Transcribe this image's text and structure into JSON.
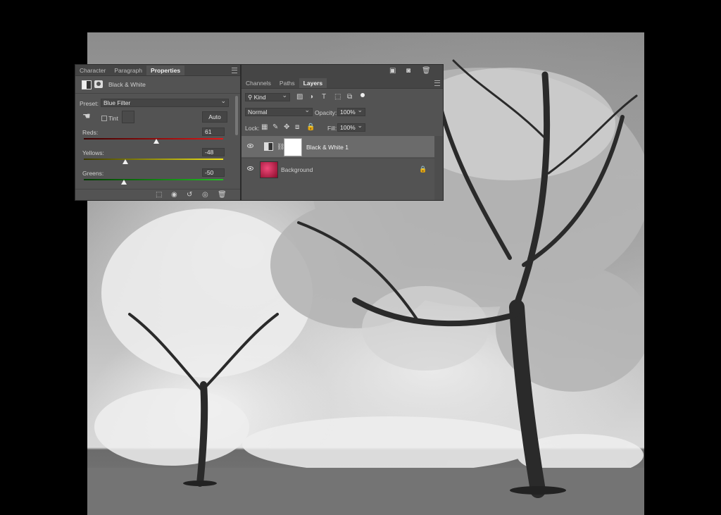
{
  "properties_panel": {
    "tabs": [
      "Character",
      "Paragraph",
      "Properties"
    ],
    "active_tab": "Properties",
    "adjustment_name": "Black & White",
    "preset_label": "Preset:",
    "preset_value": "Blue Filter",
    "tint_label": "Tint",
    "auto_label": "Auto",
    "sliders": [
      {
        "label": "Reds:",
        "value": "61",
        "level": 0.52
      },
      {
        "label": "Yellows:",
        "value": "-48",
        "level": 0.3
      },
      {
        "label": "Greens:",
        "value": "-50",
        "level": 0.29
      }
    ],
    "footer_icons": [
      "clip-to-layer-icon",
      "view-previous-icon",
      "reset-icon",
      "visibility-icon",
      "delete-icon"
    ]
  },
  "layers_panel": {
    "tabs": [
      "Channels",
      "Paths",
      "Layers"
    ],
    "active_tab": "Layers",
    "filter_kind": "Kind",
    "blend_mode": "Normal",
    "opacity_label": "Opacity:",
    "opacity_value": "100%",
    "lock_label": "Lock:",
    "fill_label": "Fill:",
    "fill_value": "100%",
    "layers": [
      {
        "name": "Black & White 1",
        "selected": true,
        "visible": true
      },
      {
        "name": "Background",
        "selected": false,
        "visible": true,
        "locked": true
      }
    ]
  },
  "colors": {
    "panel_bg": "#535353",
    "selected_row": "#6b6b6b",
    "reds_gradient": [
      "#2a0000",
      "#ff2020"
    ],
    "yellows_gradient": [
      "#2a2a00",
      "#ffee20"
    ],
    "greens_gradient": [
      "#002a00",
      "#20d020"
    ]
  }
}
